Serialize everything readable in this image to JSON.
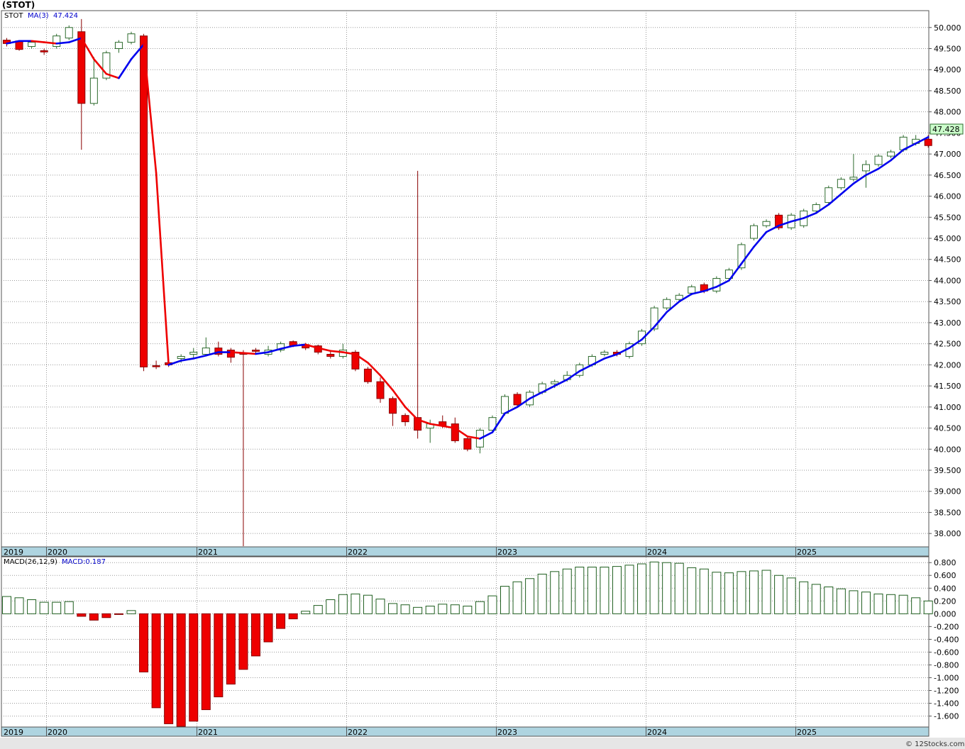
{
  "colors": {
    "up_fill": "#ffffff",
    "up_stroke": "#2e6b2e",
    "down_fill": "#ee0000",
    "down_stroke": "#880000",
    "ma_up": "#0000ee",
    "ma_down": "#ee0000",
    "grid": "#9a9a9a",
    "axis_band": "#aed4e0",
    "price_tag_bg": "#ccffcc",
    "macd_pos_stroke": "#1f5f1f",
    "macd_neg_fill": "#ee0000"
  },
  "header": {
    "symbol": "(STOT)",
    "ticker": "STOT",
    "ma_label": "MA(3)",
    "ma_value": "47.424"
  },
  "price_tag": "47.428",
  "macd_legend": {
    "label": "MACD(26,12,9)",
    "value_label": "MACD:0.187"
  },
  "footer": "© 12Stocks.com",
  "chart_data": [
    {
      "type": "candlestick",
      "ylim": [
        37.7,
        50.4
      ],
      "y_ticks": [
        "38.000",
        "38.500",
        "39.000",
        "39.500",
        "40.000",
        "40.500",
        "41.000",
        "41.500",
        "42.000",
        "42.500",
        "43.000",
        "43.500",
        "44.000",
        "44.500",
        "45.000",
        "45.500",
        "46.000",
        "46.500",
        "47.000",
        "47.500",
        "48.000",
        "48.500",
        "49.000",
        "49.500",
        "50.000"
      ],
      "x_labels": [
        "2019",
        "2020",
        "2021",
        "2022",
        "2023",
        "2024",
        "2025"
      ],
      "candles": [
        [
          49.7,
          49.75,
          49.55,
          49.62
        ],
        [
          49.68,
          49.7,
          49.45,
          49.48
        ],
        [
          49.55,
          49.7,
          49.5,
          49.65
        ],
        [
          49.45,
          49.5,
          49.35,
          49.42
        ],
        [
          49.55,
          49.85,
          49.5,
          49.8
        ],
        [
          49.75,
          50.05,
          49.7,
          50.0
        ],
        [
          49.9,
          50.2,
          47.1,
          48.2
        ],
        [
          48.2,
          49.3,
          48.15,
          48.8
        ],
        [
          48.8,
          49.45,
          48.75,
          49.4
        ],
        [
          49.5,
          49.7,
          49.4,
          49.65
        ],
        [
          49.65,
          49.9,
          49.6,
          49.85
        ],
        [
          49.8,
          49.85,
          41.85,
          41.95
        ],
        [
          41.98,
          42.1,
          41.9,
          41.96
        ],
        [
          42.05,
          42.1,
          41.95,
          42.0
        ],
        [
          42.15,
          42.25,
          42.05,
          42.2
        ],
        [
          42.25,
          42.4,
          42.15,
          42.3
        ],
        [
          42.25,
          42.65,
          42.2,
          42.4
        ],
        [
          42.4,
          42.55,
          42.2,
          42.25
        ],
        [
          42.35,
          42.4,
          42.05,
          42.18
        ],
        [
          42.28,
          42.35,
          37.7,
          42.25
        ],
        [
          42.35,
          42.4,
          42.25,
          42.32
        ],
        [
          42.25,
          42.45,
          42.2,
          42.35
        ],
        [
          42.35,
          42.55,
          42.3,
          42.5
        ],
        [
          42.55,
          42.58,
          42.42,
          42.45
        ],
        [
          42.48,
          42.52,
          42.35,
          42.4
        ],
        [
          42.45,
          42.48,
          42.25,
          42.3
        ],
        [
          42.25,
          42.35,
          42.15,
          42.2
        ],
        [
          42.2,
          42.5,
          42.15,
          42.35
        ],
        [
          42.3,
          42.35,
          41.85,
          41.9
        ],
        [
          41.9,
          41.95,
          41.55,
          41.6
        ],
        [
          41.6,
          41.7,
          41.1,
          41.2
        ],
        [
          41.2,
          41.25,
          40.55,
          40.85
        ],
        [
          40.8,
          40.85,
          40.55,
          40.65
        ],
        [
          40.75,
          46.6,
          40.25,
          40.45
        ],
        [
          40.5,
          40.7,
          40.15,
          40.6
        ],
        [
          40.65,
          40.8,
          40.5,
          40.55
        ],
        [
          40.6,
          40.75,
          40.15,
          40.2
        ],
        [
          40.25,
          40.3,
          39.95,
          40.0
        ],
        [
          40.05,
          40.5,
          39.9,
          40.45
        ],
        [
          40.45,
          40.8,
          40.4,
          40.75
        ],
        [
          40.85,
          41.3,
          40.8,
          41.25
        ],
        [
          41.3,
          41.35,
          41.0,
          41.05
        ],
        [
          41.05,
          41.4,
          41.0,
          41.35
        ],
        [
          41.35,
          41.6,
          41.3,
          41.55
        ],
        [
          41.55,
          41.65,
          41.45,
          41.6
        ],
        [
          41.65,
          41.85,
          41.6,
          41.75
        ],
        [
          41.75,
          42.05,
          41.7,
          42.0
        ],
        [
          42.0,
          42.25,
          41.95,
          42.2
        ],
        [
          42.25,
          42.35,
          42.2,
          42.3
        ],
        [
          42.3,
          42.35,
          42.2,
          42.25
        ],
        [
          42.2,
          42.55,
          42.15,
          42.5
        ],
        [
          42.5,
          42.85,
          42.45,
          42.8
        ],
        [
          42.85,
          43.4,
          42.8,
          43.35
        ],
        [
          43.35,
          43.6,
          43.3,
          43.55
        ],
        [
          43.55,
          43.7,
          43.5,
          43.65
        ],
        [
          43.7,
          43.9,
          43.65,
          43.85
        ],
        [
          43.9,
          43.95,
          43.7,
          43.75
        ],
        [
          43.75,
          44.1,
          43.7,
          44.05
        ],
        [
          44.05,
          44.3,
          44.0,
          44.25
        ],
        [
          44.3,
          44.9,
          44.25,
          44.85
        ],
        [
          45.0,
          45.35,
          44.95,
          45.3
        ],
        [
          45.3,
          45.45,
          45.25,
          45.4
        ],
        [
          45.55,
          45.6,
          45.2,
          45.25
        ],
        [
          45.25,
          45.6,
          45.2,
          45.55
        ],
        [
          45.3,
          45.7,
          45.25,
          45.65
        ],
        [
          45.65,
          45.85,
          45.6,
          45.8
        ],
        [
          45.85,
          46.25,
          45.8,
          46.2
        ],
        [
          46.2,
          46.45,
          46.15,
          46.4
        ],
        [
          46.4,
          47.0,
          46.35,
          46.45
        ],
        [
          46.6,
          46.85,
          46.2,
          46.75
        ],
        [
          46.75,
          47.0,
          46.7,
          46.95
        ],
        [
          46.95,
          47.1,
          46.9,
          47.05
        ],
        [
          47.1,
          47.45,
          47.05,
          47.4
        ],
        [
          47.25,
          47.45,
          47.2,
          47.35
        ],
        [
          47.35,
          47.45,
          47.15,
          47.2
        ]
      ],
      "ma_values": [
        49.62,
        49.68,
        49.68,
        49.65,
        49.62,
        49.65,
        49.75,
        49.25,
        48.9,
        48.8,
        49.25,
        49.6,
        46.55,
        42.0,
        42.1,
        42.15,
        42.22,
        42.3,
        42.3,
        42.28,
        42.26,
        42.3,
        42.38,
        42.45,
        42.48,
        42.4,
        42.33,
        42.3,
        42.25,
        42.05,
        41.75,
        41.4,
        41.0,
        40.7,
        40.6,
        40.55,
        40.5,
        40.3,
        40.25,
        40.4,
        40.85,
        41.0,
        41.2,
        41.35,
        41.5,
        41.65,
        41.85,
        42.0,
        42.15,
        42.25,
        42.4,
        42.6,
        42.9,
        43.25,
        43.5,
        43.68,
        43.75,
        43.85,
        44.0,
        44.4,
        44.8,
        45.15,
        45.3,
        45.4,
        45.48,
        45.6,
        45.8,
        46.05,
        46.3,
        46.5,
        46.65,
        46.85,
        47.1,
        47.25,
        47.4
      ]
    },
    {
      "type": "bar",
      "title": "MACD(26,12,9)",
      "ylim": [
        -1.76,
        0.88
      ],
      "y_ticks": [
        "0.800",
        "0.600",
        "0.400",
        "0.200",
        "0.000",
        "-0.200",
        "-0.400",
        "-0.600",
        "-0.800",
        "-1.000",
        "-1.200",
        "-1.400",
        "-1.600"
      ],
      "x_labels": [
        "2019",
        "2020",
        "2021",
        "2022",
        "2023",
        "2024",
        "2025"
      ],
      "values": [
        0.27,
        0.25,
        0.22,
        0.18,
        0.18,
        0.19,
        -0.04,
        -0.1,
        -0.06,
        -0.01,
        0.05,
        -0.91,
        -1.47,
        -1.72,
        -1.76,
        -1.68,
        -1.5,
        -1.3,
        -1.1,
        -0.87,
        -0.66,
        -0.44,
        -0.23,
        -0.08,
        0.04,
        0.13,
        0.22,
        0.3,
        0.31,
        0.29,
        0.23,
        0.16,
        0.14,
        0.1,
        0.12,
        0.15,
        0.14,
        0.12,
        0.19,
        0.28,
        0.43,
        0.5,
        0.55,
        0.62,
        0.66,
        0.7,
        0.73,
        0.73,
        0.73,
        0.74,
        0.76,
        0.78,
        0.81,
        0.8,
        0.79,
        0.72,
        0.7,
        0.65,
        0.64,
        0.66,
        0.67,
        0.68,
        0.6,
        0.56,
        0.5,
        0.46,
        0.42,
        0.39,
        0.36,
        0.34,
        0.31,
        0.3,
        0.29,
        0.25,
        0.2
      ]
    }
  ]
}
